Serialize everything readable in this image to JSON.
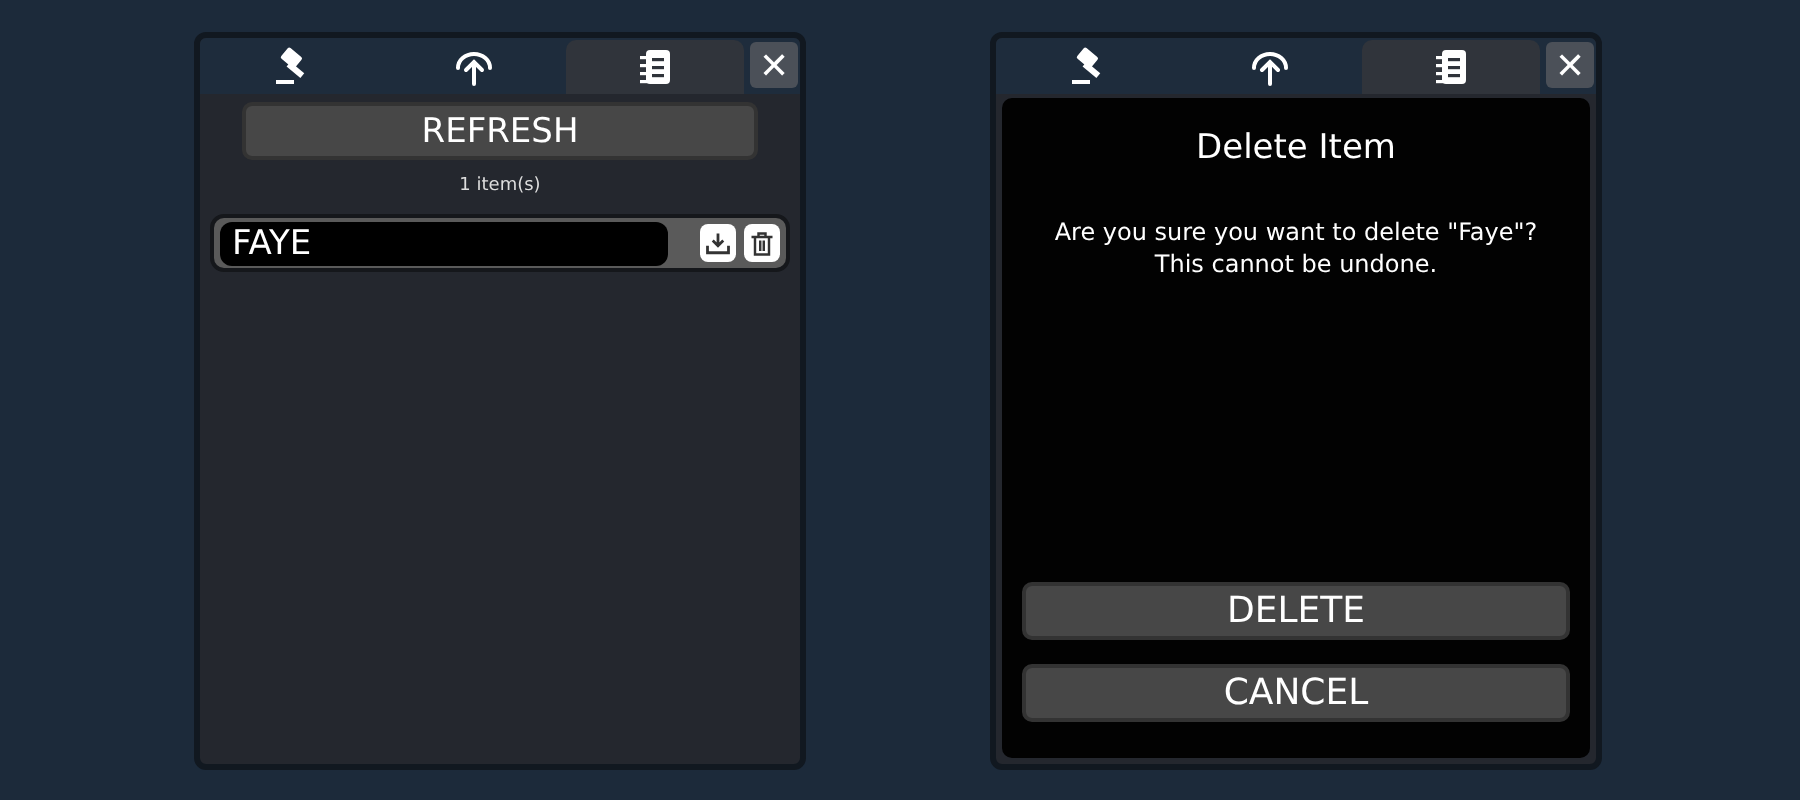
{
  "panels": [
    {
      "tabs": [
        {
          "selected": false
        },
        {
          "selected": false
        },
        {
          "selected": true
        }
      ],
      "close": "✕",
      "content": {
        "kind": "list",
        "refresh": "REFRESH",
        "count": "1 item(s)",
        "items": [
          {
            "name": "FAYE"
          }
        ]
      }
    },
    {
      "tabs": [
        {
          "selected": false
        },
        {
          "selected": false
        },
        {
          "selected": true
        }
      ],
      "close": "✕",
      "content": {
        "kind": "dialog",
        "title": "Delete Item",
        "message": "Are you sure you want to delete \"Faye\"?\nThis cannot be undone.",
        "buttons": [
          "DELETE",
          "CANCEL"
        ]
      }
    }
  ]
}
